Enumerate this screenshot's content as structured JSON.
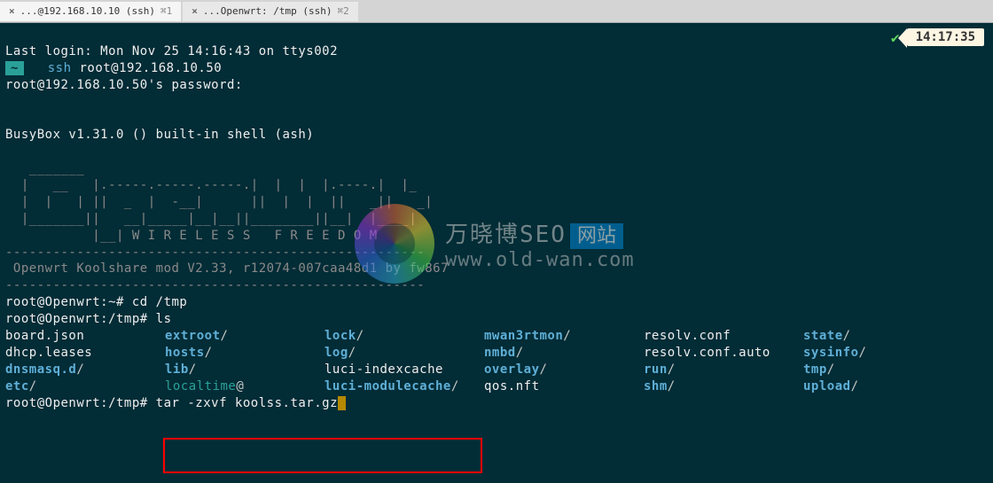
{
  "tabs": {
    "t1": {
      "label": "...@192.168.10.10 (ssh)",
      "shortcut": "⌘1"
    },
    "t2": {
      "label": "...Openwrt: /tmp (ssh)",
      "shortcut": "⌘2"
    }
  },
  "terminal": {
    "last_login": "Last login: Mon Nov 25 14:16:43 on ttys002",
    "prompt1_cwd": "~",
    "prompt1_cmd": "ssh",
    "prompt1_args": " root@192.168.10.50",
    "password_prompt": "root@192.168.10.50's password:",
    "busybox": "BusyBox v1.31.0 () built-in shell (ash)",
    "ascii1": "   _______",
    "ascii2": "  |   __   |.-----.-----.-----.|  |  |  |.----.|  |_",
    "ascii3": "  |  |   | ||  _  |  -__|      ||  |  |  ||   _||   _|",
    "ascii4": "  |_______||   __|_____|__|__||________||__|  |____|",
    "ascii5": "           |__| W I R E L E S S   F R E E D O M",
    "dashes": "-----------------------------------------------------",
    "version": " Openwrt Koolshare mod V2.33, r12074-007caa48d1 by fw867",
    "dashes2": "-----------------------------------------------------",
    "prompt2": "root@Openwrt:~# ",
    "cmd2": "cd /tmp",
    "prompt3": "root@Openwrt:/tmp# ",
    "cmd3": "ls",
    "prompt4": "root@Openwrt:/tmp# ",
    "cmd4": "tar -zxvf koolss.tar.gz"
  },
  "ls": {
    "row1": {
      "c1": "board.json",
      "c2": "extroot",
      "c3": "lock",
      "c4": "mwan3rtmon",
      "c5": "resolv.conf",
      "c6": "state"
    },
    "row2": {
      "c1": "dhcp.leases",
      "c2": "hosts",
      "c3": "log",
      "c4": "nmbd",
      "c5": "resolv.conf.auto",
      "c6": "sysinfo"
    },
    "row3": {
      "c1": "dnsmasq.d",
      "c2": "lib",
      "c3": "luci-indexcache",
      "c4": "overlay",
      "c5": "run",
      "c6": "tmp"
    },
    "row4": {
      "c1": "etc",
      "c2": "localtime",
      "c3": "luci-modulecache",
      "c4": "qos.nft",
      "c5": "shm",
      "c6": "upload"
    }
  },
  "status": {
    "time": "14:17:35"
  },
  "watermark": {
    "text1": "万晓博SEO",
    "badge": "网站",
    "url": "www.old-wan.com"
  }
}
